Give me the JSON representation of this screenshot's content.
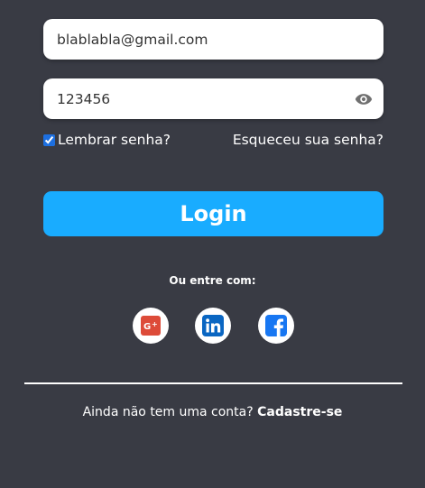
{
  "login_form": {
    "email": {
      "value": "blablabla@gmail.com",
      "placeholder": ""
    },
    "password": {
      "value": "123456",
      "placeholder": ""
    },
    "remember_label": "Lembrar senha?",
    "remember_checked": true,
    "forgot_link": "Esqueceu sua senha?",
    "submit_label": "Login",
    "show_password_icon": "eye-icon"
  },
  "social": {
    "label": "Ou entre com:",
    "providers": [
      {
        "name": "google-plus",
        "icon": "google-plus-icon",
        "color": "#dd4b39"
      },
      {
        "name": "linkedin",
        "icon": "linkedin-icon",
        "color": "#0a66c2"
      },
      {
        "name": "facebook",
        "icon": "facebook-icon",
        "color": "#1877f2"
      }
    ]
  },
  "signup": {
    "prompt": "Ainda não tem uma conta?",
    "link": "Cadastre-se"
  },
  "colors": {
    "background": "#393b44",
    "primary_button": "#19acff",
    "text": "#ffffff"
  }
}
